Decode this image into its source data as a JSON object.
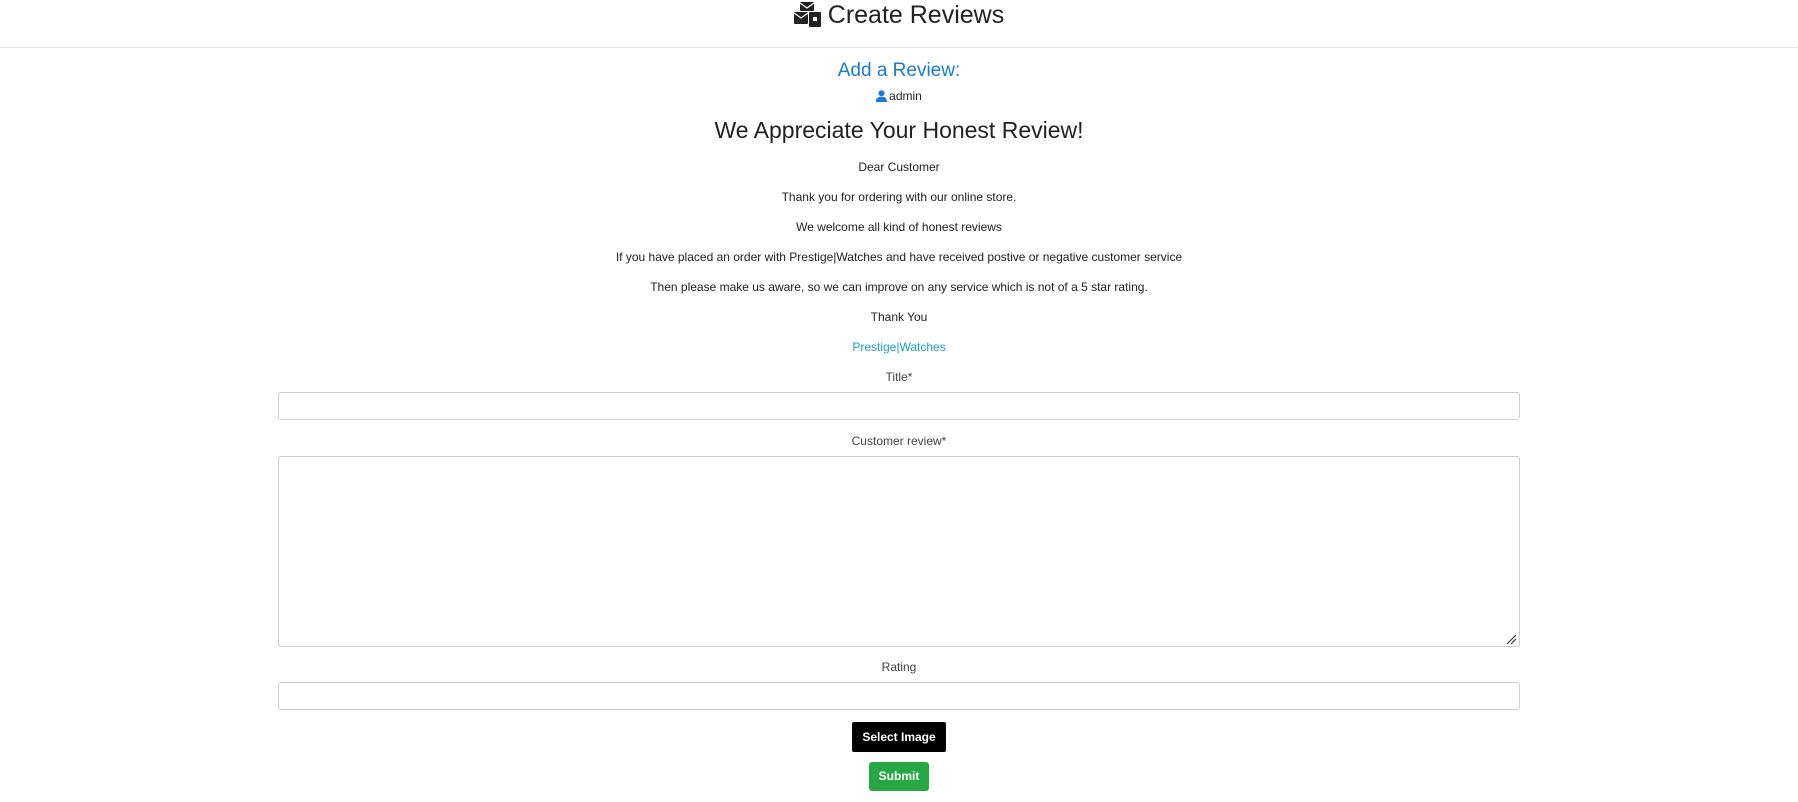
{
  "header": {
    "title": "Create Reviews",
    "icon": "mail-bulk-icon"
  },
  "review": {
    "heading": "Add a Review:",
    "user_icon": "user-icon",
    "username": "admin",
    "appreciate": "We Appreciate Your Honest Review!",
    "messages": [
      "Dear Customer",
      "Thank you for ordering with our online store.",
      "We welcome all kind of honest reviews",
      "If you have placed an order with Prestige|Watches and have received postive or negative customer service",
      "Then please make us aware, so we can improve on any service which is not of a 5 star rating.",
      "Thank You"
    ],
    "signature": "Prestige|Watches"
  },
  "form": {
    "title_label": "Title*",
    "title_value": "",
    "review_label": "Customer review*",
    "review_value": "",
    "rating_label": "Rating",
    "rating_value": "",
    "select_image_label": "Select Image",
    "submit_label": "Submit"
  },
  "colors": {
    "heading_blue": "#1a7bd1",
    "brand_teal": "#1aa0c6",
    "submit_green": "#28a745",
    "select_black": "#000000"
  }
}
